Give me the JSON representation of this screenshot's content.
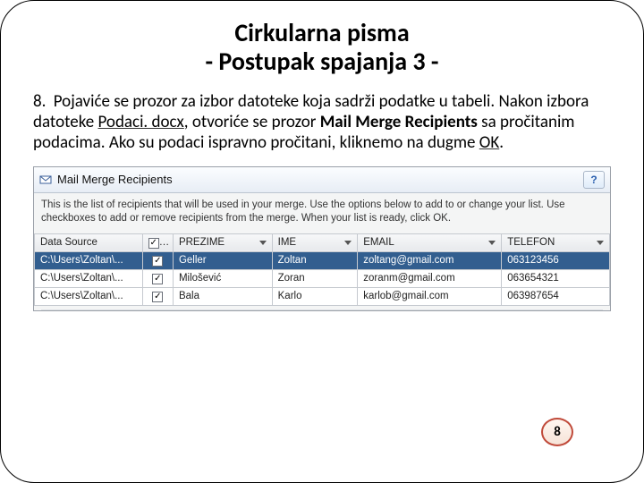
{
  "slide": {
    "title_line1": "Cirkularna pisma",
    "title_line2": "- Postupak spajanja 3 -",
    "page_number": "8"
  },
  "body": {
    "step_number": "8.",
    "text_before_underline": " Pojaviće se prozor za izbor datoteke koja sadrži podatke u tabeli. Nakon izbora datoteke ",
    "underline_text": "Podaci. docx",
    "text_after_underline": ", otvoriće se prozor ",
    "bold_text": "Mail Merge Recipients",
    "text_after_bold": "  sa pročitanim podacima. Ako su podaci ispravno pročitani, kliknemo na dugme ",
    "ok_text": "OK",
    "text_end": "."
  },
  "dialog": {
    "title": "Mail Merge Recipients",
    "help_icon_text": "?",
    "description": "This is the list of recipients that will be used in your merge.  Use the options below to add to or change your list.  Use checkboxes to add or remove recipients from the merge.  When your list is ready, click OK.",
    "columns": {
      "data_source": "Data Source",
      "prezime": "PREZIME",
      "ime": "IME",
      "email": "EMAIL",
      "telefon": "TELEFON"
    },
    "rows": [
      {
        "ds": "C:\\Users\\Zoltan\\...",
        "checked": true,
        "prezime": "Geller",
        "ime": "Zoltan",
        "email": "zoltang@gmail.com",
        "telefon": "063123456",
        "selected": true
      },
      {
        "ds": "C:\\Users\\Zoltan\\...",
        "checked": true,
        "prezime": "Milošević",
        "ime": "Zoran",
        "email": "zoranm@gmail.com",
        "telefon": "063654321",
        "selected": false
      },
      {
        "ds": "C:\\Users\\Zoltan\\...",
        "checked": true,
        "prezime": "Bala",
        "ime": "Karlo",
        "email": "karlob@gmail.com",
        "telefon": "063987654",
        "selected": false
      }
    ]
  }
}
